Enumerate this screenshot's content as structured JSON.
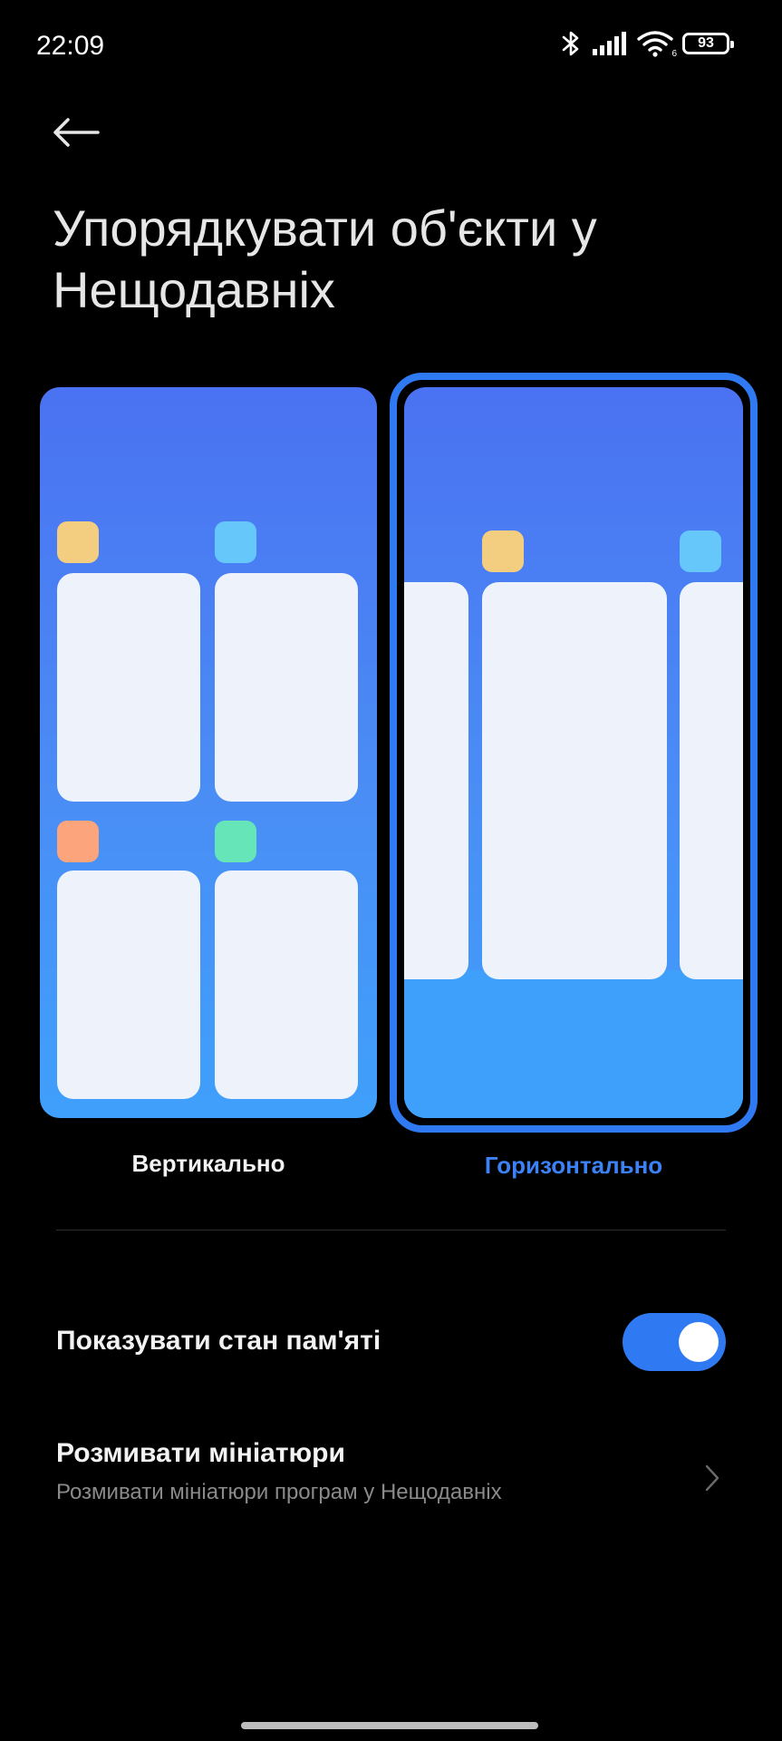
{
  "status_bar": {
    "time": "22:09",
    "battery_level": "93",
    "icons": [
      "bluetooth-icon",
      "cellular-signal-icon",
      "wifi-icon",
      "battery-icon"
    ],
    "wifi_badge": "6"
  },
  "header": {
    "back_icon": "arrow-left-icon",
    "title": "Упорядкувати об'єкти у Нещодавніх"
  },
  "layout_options": {
    "selected": "horizontal",
    "vertical": {
      "label": "Вертикально",
      "icon_colors": [
        "#f4ce80",
        "#66c7fb",
        "#fca47c",
        "#66e6b8"
      ]
    },
    "horizontal": {
      "label": "Горизонтально",
      "icon_colors": [
        "#f4ce80",
        "#66c7fb"
      ]
    }
  },
  "settings": {
    "show_memory": {
      "title": "Показувати стан пам'яті",
      "enabled": true
    },
    "blur_previews": {
      "title": "Розмивати мініатюри",
      "subtitle": "Розмивати мініатюри програм у Нещодавніх",
      "chevron_icon": "chevron-right-icon"
    }
  },
  "colors": {
    "background": "#000000",
    "accent": "#2f7af2",
    "selected_label": "#3b82f6",
    "card": "#edf2fb",
    "subtitle": "#8a8a8a"
  }
}
